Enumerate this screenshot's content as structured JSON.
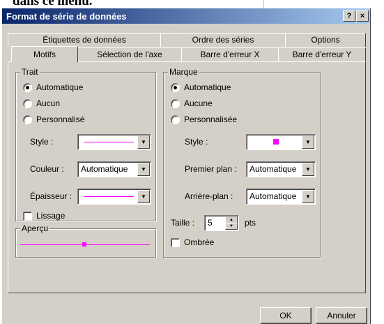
{
  "background_text": "dans ce menu.",
  "dialog": {
    "title": "Format de série de données",
    "help_label": "?",
    "close_label": "×"
  },
  "tabs_back": [
    "Étiquettes de données",
    "Ordre des séries",
    "Options"
  ],
  "tabs_front": [
    "Motifs",
    "Sélection de l'axe",
    "Barre d'erreur X",
    "Barre d'erreur Y"
  ],
  "trait": {
    "legend": "Trait",
    "options": [
      "Automatique",
      "Aucun",
      "Personnalisé"
    ],
    "selected": "Automatique",
    "style_label": "Style :",
    "couleur_label": "Couleur :",
    "couleur_value": "Automatique",
    "epaisseur_label": "Épaisseur :",
    "lissage_label": "Lissage",
    "lissage_checked": false
  },
  "marque": {
    "legend": "Marque",
    "options": [
      "Automatique",
      "Aucune",
      "Personnalisée"
    ],
    "selected": "Automatique",
    "style_label": "Style :",
    "premier_plan_label": "Premier plan :",
    "premier_plan_value": "Automatique",
    "arriere_plan_label": "Arrière-plan :",
    "arriere_plan_value": "Automatique",
    "taille_label": "Taille :",
    "taille_value": "5",
    "taille_unit": "pts",
    "ombree_label": "Ombrée",
    "ombree_checked": false
  },
  "apercu": {
    "legend": "Aperçu"
  },
  "buttons": {
    "ok": "OK",
    "cancel": "Annuler"
  },
  "colors": {
    "line_color": "#ff00ff",
    "dialog_bg": "#d4d0c8",
    "title_start": "#0a246a",
    "title_end": "#a6caf0"
  }
}
